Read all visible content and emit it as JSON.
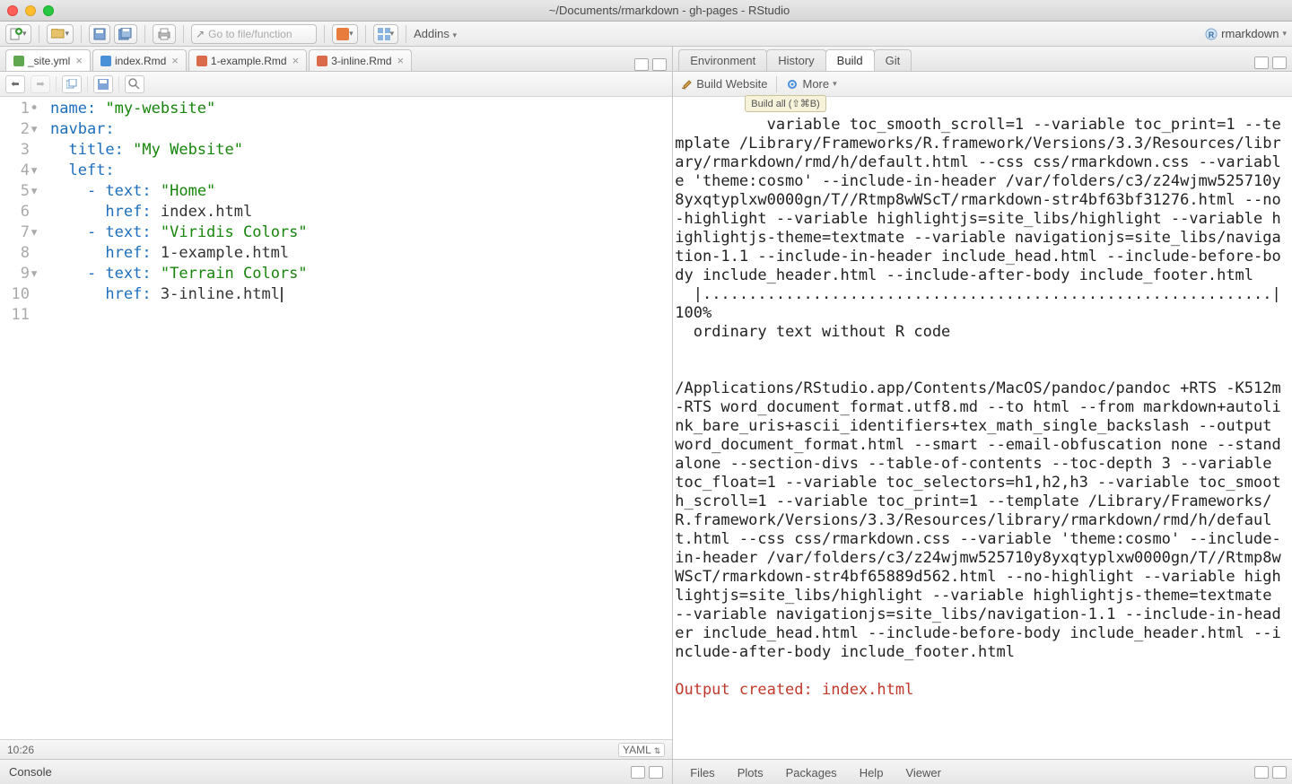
{
  "window": {
    "title": "~/Documents/rmarkdown - gh-pages - RStudio"
  },
  "toolbar": {
    "goto_placeholder": "Go to file/function",
    "addins_label": "Addins",
    "project_name": "rmarkdown"
  },
  "source": {
    "tabs": [
      {
        "name": "_site.yml",
        "color": "#5fa84f"
      },
      {
        "name": "index.Rmd",
        "color": "#4a90d9"
      },
      {
        "name": "1-example.Rmd",
        "color": "#d96b4a"
      },
      {
        "name": "3-inline.Rmd",
        "color": "#d96b4a"
      }
    ],
    "lines": [
      {
        "n": "1",
        "fold": "•",
        "indent": 0,
        "key": "name:",
        "val": "\"my-website\""
      },
      {
        "n": "2",
        "fold": "▾",
        "indent": 0,
        "key": "navbar:",
        "val": ""
      },
      {
        "n": "3",
        "fold": "",
        "indent": 1,
        "key": "title:",
        "val": "\"My Website\""
      },
      {
        "n": "4",
        "fold": "▾",
        "indent": 1,
        "key": "left:",
        "val": ""
      },
      {
        "n": "5",
        "fold": "▾",
        "indent": 2,
        "dash": "- ",
        "key": "text:",
        "val": "\"Home\""
      },
      {
        "n": "6",
        "fold": "",
        "indent": 3,
        "key": "href:",
        "val": "index.html",
        "plain": true
      },
      {
        "n": "7",
        "fold": "▾",
        "indent": 2,
        "dash": "- ",
        "key": "text:",
        "val": "\"Viridis Colors\""
      },
      {
        "n": "8",
        "fold": "",
        "indent": 3,
        "key": "href:",
        "val": "1-example.html",
        "plain": true
      },
      {
        "n": "9",
        "fold": "▾",
        "indent": 2,
        "dash": "- ",
        "key": "text:",
        "val": "\"Terrain Colors\""
      },
      {
        "n": "10",
        "fold": "",
        "indent": 3,
        "key": "href:",
        "val": "3-inline.html",
        "plain": true,
        "cursor": true
      },
      {
        "n": "11",
        "fold": "",
        "indent": 0,
        "key": "",
        "val": ""
      }
    ],
    "status": {
      "cursor": "10:26",
      "lang": "YAML"
    }
  },
  "console": {
    "tab_label": "Console"
  },
  "right_top": {
    "tabs": [
      "Environment",
      "History",
      "Build",
      "Git"
    ],
    "active": 2,
    "build_btn": "Build Website",
    "more_btn": "More",
    "tooltip": "Build all (⇧⌘B)",
    "output_main": "variable toc_smooth_scroll=1 --variable toc_print=1 --template /Library/Frameworks/R.framework/Versions/3.3/Resources/library/rmarkdown/rmd/h/default.html --css css/rmarkdown.css --variable 'theme:cosmo' --include-in-header /var/folders/c3/z24wjmw525710y8yxqtyplxw0000gn/T//Rtmp8wWScT/rmarkdown-str4bf63bf31276.html --no-highlight --variable highlightjs=site_libs/highlight --variable highlightjs-theme=textmate --variable navigationjs=site_libs/navigation-1.1 --include-in-header include_head.html --include-before-body include_header.html --include-after-body include_footer.html\n  |..............................................................| 100%\n  ordinary text without R code\n\n\n/Applications/RStudio.app/Contents/MacOS/pandoc/pandoc +RTS -K512m -RTS word_document_format.utf8.md --to html --from markdown+autolink_bare_uris+ascii_identifiers+tex_math_single_backslash --output word_document_format.html --smart --email-obfuscation none --standalone --section-divs --table-of-contents --toc-depth 3 --variable toc_float=1 --variable toc_selectors=h1,h2,h3 --variable toc_smooth_scroll=1 --variable toc_print=1 --template /Library/Frameworks/R.framework/Versions/3.3/Resources/library/rmarkdown/rmd/h/default.html --css css/rmarkdown.css --variable 'theme:cosmo' --include-in-header /var/folders/c3/z24wjmw525710y8yxqtyplxw0000gn/T//Rtmp8wWScT/rmarkdown-str4bf65889d562.html --no-highlight --variable highlightjs=site_libs/highlight --variable highlightjs-theme=textmate --variable navigationjs=site_libs/navigation-1.1 --include-in-header include_head.html --include-before-body include_header.html --include-after-body include_footer.html",
    "output_final": "Output created: index.html"
  },
  "right_bottom": {
    "tabs": [
      "Files",
      "Plots",
      "Packages",
      "Help",
      "Viewer"
    ]
  }
}
